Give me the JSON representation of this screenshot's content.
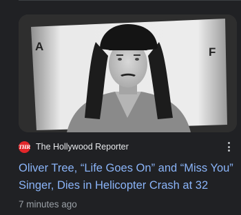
{
  "article": {
    "source": {
      "name": "The Hollywood Reporter",
      "logo_text": "THR",
      "logo_color": "#e3262a"
    },
    "headline": "Oliver Tree, “Life Goes On” and “Miss You” Singer, Dies in Helicopter Crash at 32",
    "timestamp": "7 minutes ago",
    "more_options_icon": "more-vert-icon",
    "thumbnail": {
      "backdrop_letter_left": "A",
      "backdrop_letter_right": "F"
    },
    "colors": {
      "headline": "#8ab4f8",
      "background": "#202124"
    }
  }
}
